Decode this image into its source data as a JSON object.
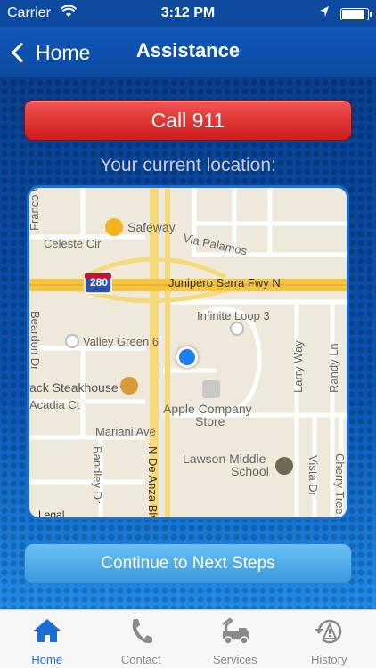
{
  "status_bar": {
    "carrier": "Carrier",
    "time": "3:12 PM",
    "battery_level": 0.95
  },
  "nav": {
    "back_label": "Home",
    "title": "Assistance"
  },
  "call_button": {
    "label": "Call 911",
    "color": "#d92525"
  },
  "location_heading": "Your current location:",
  "map": {
    "labels": {
      "franco": "Franco C",
      "safeway": "Safeway",
      "celeste": "Celeste Cir",
      "via_palamos": "Via Palamos",
      "interstate": "280",
      "junipero": "Junipero Serra Fwy N",
      "infinite_loop": "Infinite Loop 3",
      "beardon": "Beardon Dr",
      "valley_green": "Valley Green 6",
      "larry": "Larry Way",
      "randy": "Randy Ln",
      "steakhouse": "ack Steakhouse",
      "acadia": "Acadia Ct",
      "apple_store_1": "Apple Company",
      "apple_store_2": "Store",
      "mariani": "Mariani Ave",
      "bandley": "Bandley Dr",
      "de_anza": "N De Anza Blvd",
      "lawson_1": "Lawson Middle",
      "lawson_2": "School",
      "vista": "Vista Dr",
      "cherry": "Cherry Tree Ln"
    },
    "legal": "Legal"
  },
  "continue_button": {
    "label": "Continue to Next Steps"
  },
  "tabs": [
    {
      "label": "Home",
      "icon": "home-icon",
      "active": true
    },
    {
      "label": "Contact",
      "icon": "phone-icon",
      "active": false
    },
    {
      "label": "Services",
      "icon": "tow-truck-icon",
      "active": false
    },
    {
      "label": "History",
      "icon": "history-icon",
      "active": false
    }
  ],
  "colors": {
    "accent": "#1a6fd4",
    "nav": "#0c4aa0",
    "inactive_tab": "#8a8a8a"
  }
}
